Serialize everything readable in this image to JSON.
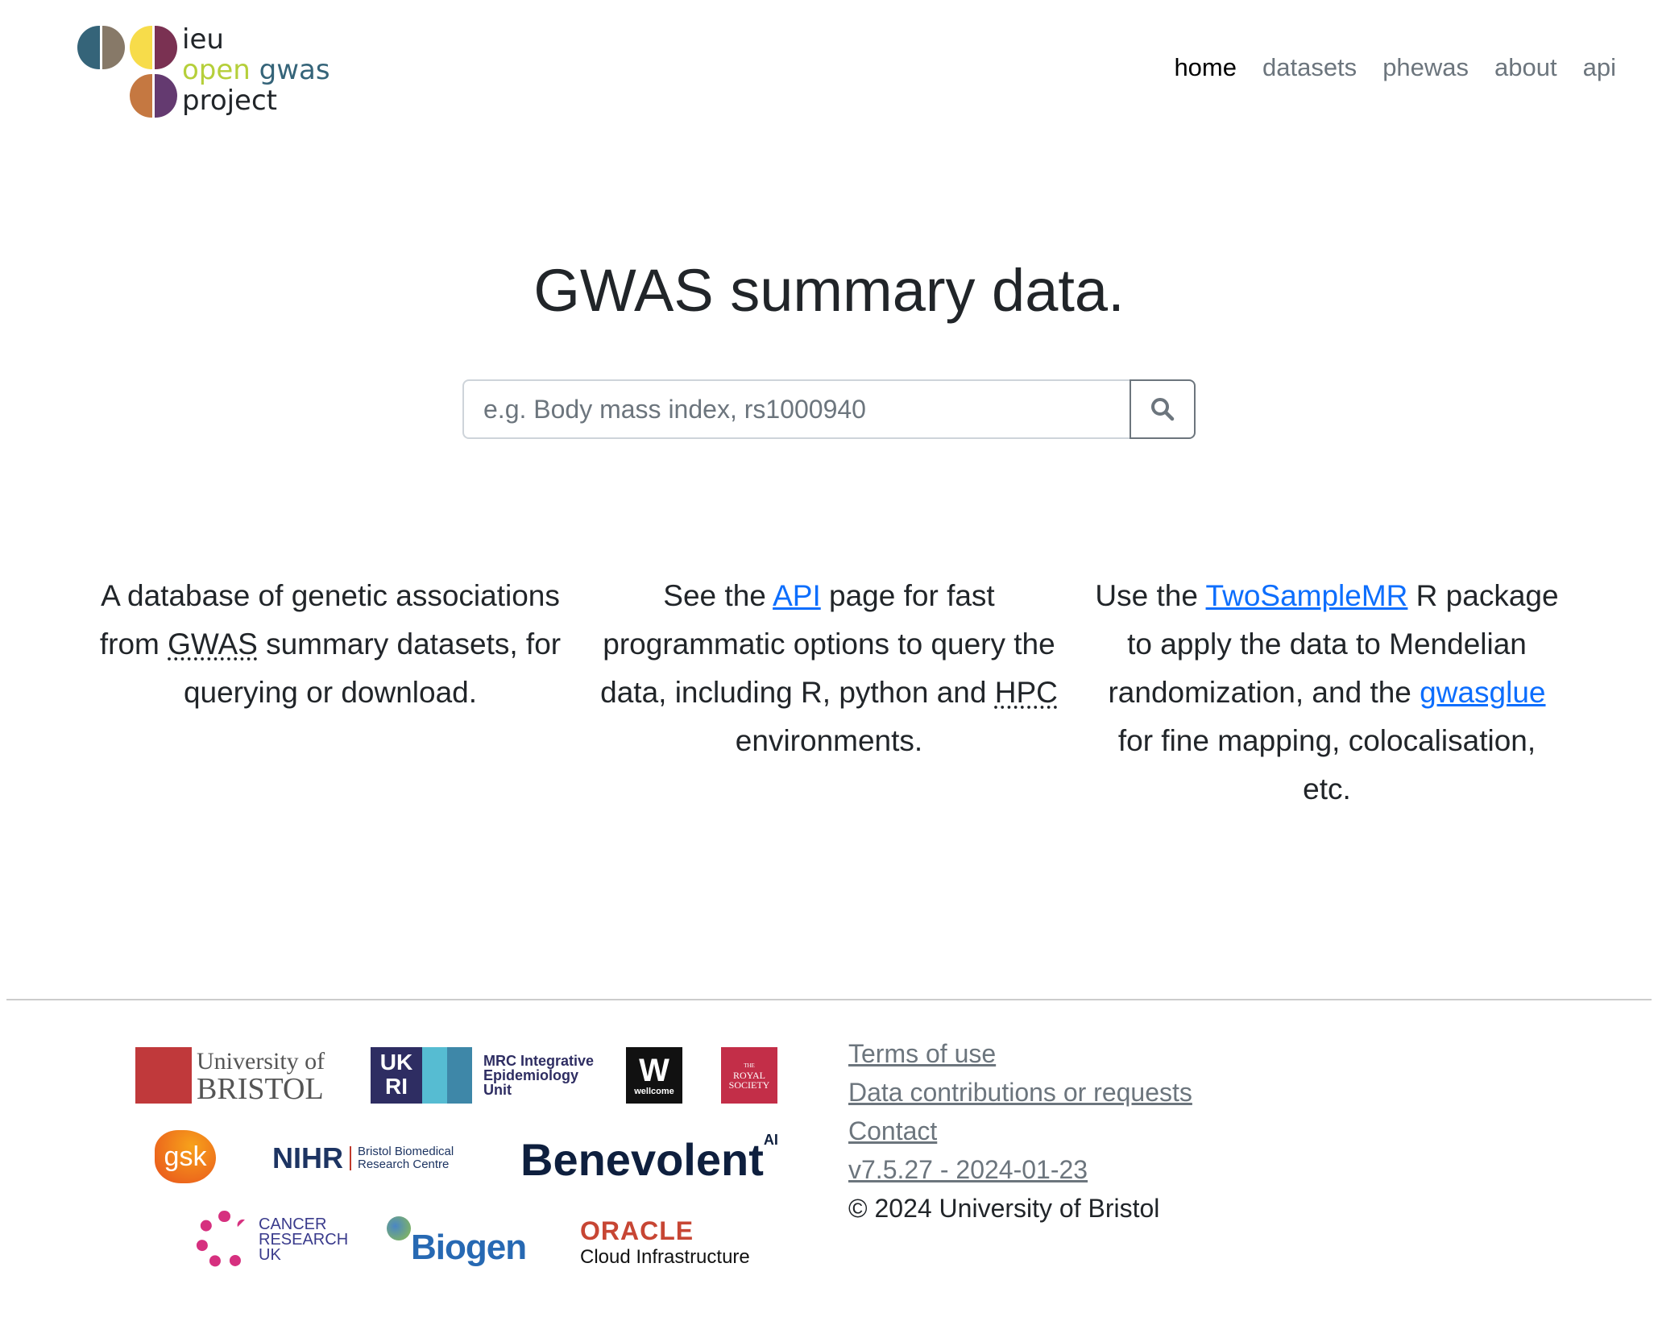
{
  "logo": {
    "line1": "ieu",
    "line2a": "open",
    "line2b": "gwas",
    "line3": "project"
  },
  "nav": [
    {
      "label": "home",
      "active": true
    },
    {
      "label": "datasets"
    },
    {
      "label": "phewas"
    },
    {
      "label": "about"
    },
    {
      "label": "api"
    }
  ],
  "hero": {
    "title": "GWAS summary data.",
    "search_placeholder": "e.g. Body mass index, rs1000940"
  },
  "columns": {
    "c1": {
      "t1": "A database of genetic associations from ",
      "abbr": "GWAS",
      "t2": " summary datasets, for querying or download."
    },
    "c2": {
      "t1": "See the ",
      "link": "API",
      "t2": " page for fast programmatic options to query the data, including R, python and ",
      "abbr": "HPC",
      "t3": " environments."
    },
    "c3": {
      "t1": "Use the ",
      "link1": "TwoSampleMR",
      "t2": " R package to apply the data to Mendelian randomization, and the ",
      "link2": "gwasglue",
      "t3": " for fine mapping, colocalisation, etc."
    }
  },
  "sponsors": {
    "bristol": [
      "University of",
      "BRISTOL"
    ],
    "ukri": [
      "UK",
      "RI"
    ],
    "mrc": [
      "MRC Integrative",
      "Epidemiology",
      "Unit"
    ],
    "wellcome": [
      "W",
      "wellcome"
    ],
    "royal": [
      "THE",
      "ROYAL",
      "SOCIETY"
    ],
    "gsk": "gsk",
    "nihr": [
      "NIHR",
      "Bristol Biomedical",
      "Research Centre"
    ],
    "benevolent": [
      "Benevolent",
      "AI"
    ],
    "cruk": [
      "CANCER",
      "RESEARCH",
      "UK"
    ],
    "biogen": "Biogen",
    "oracle": [
      "ORACLE",
      "Cloud Infrastructure"
    ]
  },
  "footer": {
    "links": [
      "Terms of use",
      "Data contributions or requests",
      "Contact",
      "v7.5.27 - 2024-01-23"
    ],
    "copyright": "© 2024 University of Bristol"
  }
}
